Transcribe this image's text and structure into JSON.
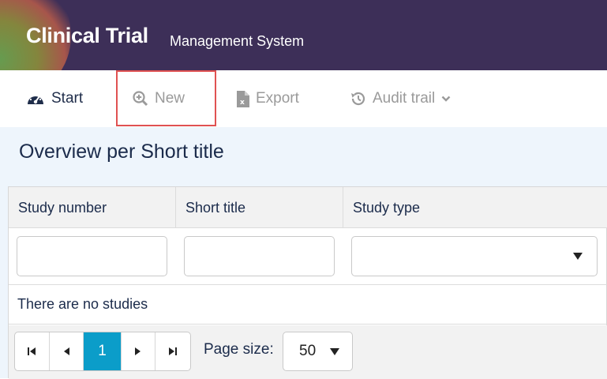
{
  "header": {
    "title_main": "Clinical Trial",
    "title_sub": "Management System"
  },
  "nav": {
    "start": {
      "label": "Start",
      "icon": "dashboard-icon"
    },
    "new": {
      "label": "New",
      "icon": "zoom-plus-icon"
    },
    "export": {
      "label": "Export",
      "icon": "excel-file-icon"
    },
    "audit": {
      "label": "Audit trail",
      "icon": "history-icon"
    }
  },
  "page": {
    "title": "Overview per Short title"
  },
  "table": {
    "columns": [
      "Study number",
      "Short title",
      "Study type"
    ],
    "empty_message": "There are no studies"
  },
  "pager": {
    "current_page": "1",
    "page_size_label": "Page size:",
    "page_size_value": "50"
  },
  "colors": {
    "header_bg": "#3d2f58",
    "highlight": "#e05252",
    "accent": "#0b9dc9",
    "content_bg": "#eef5fc"
  }
}
